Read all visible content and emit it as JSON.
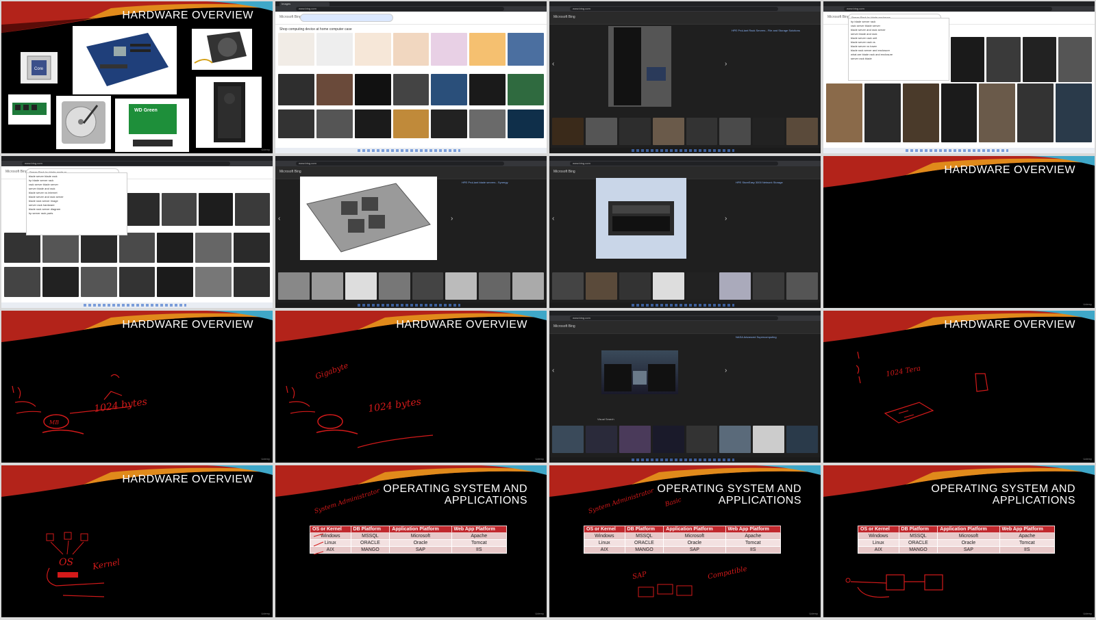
{
  "page": {
    "layout": "4x4 contact sheet of video frames",
    "watermark": "Udemy"
  },
  "slide_titles": {
    "hardware": "HARDWARE OVERVIEW",
    "os_apps": "OPERATING SYSTEM AND\nAPPLICATIONS"
  },
  "hardware_items": [
    "cpu-icon",
    "motherboard-icon",
    "power-supply-icon",
    "ram-stick-icon",
    "hard-drive-icon",
    "ssd-icon",
    "pc-case-icon"
  ],
  "ssd_label": "WD Green",
  "browser": {
    "brand": "Microsoft Bing",
    "url": "www.bing.com",
    "tab_label": "Images",
    "search_results_heading": "Shop computing device at home computer case",
    "queries": {
      "rack": "Server Rack by blade enclosure",
      "blade": "Server Rack hp blade mode ro"
    },
    "autocomplete_rack": [
      "hp blade server rack",
      "rack server blade server",
      "blade server and rack server",
      "server blade and rack",
      "blade server rack unit",
      "blade server rack vs",
      "blade server vs tower",
      "blade rack server and enclosure",
      "what are blade rack and enclosure",
      "server rack blade"
    ],
    "autocomplete_blade": [
      "blade server blade rack",
      "hp blade server rack",
      "rack server blade server",
      "server blade and rack",
      "blade server vs internet",
      "blade server and rack server",
      "blade rack server image",
      "server rack hardware",
      "blade rack server diagram",
      "hp server rack parts"
    ],
    "viewer_caption_1": "HPE ProLiant Rack Servers - File and Storage Solutions",
    "viewer_caption_2": "HPE ProLiant blade servers - Synergy",
    "viewer_caption_3": "HPE StoreEasy 3000 Network Storage",
    "viewer_caption_4": "NASA Advanced Supercomputing",
    "visual_search": "Visual Search"
  },
  "table": {
    "headers": [
      "OS or Kernel",
      "DB Platform",
      "Application Platform",
      "Web App Platform"
    ],
    "rows": [
      [
        "Windows",
        "MSSQL",
        "Microsoft",
        "Apache"
      ],
      [
        "Linux",
        "ORACLE",
        "Oracle",
        "Tomcat"
      ],
      [
        "AIX",
        "MANGO",
        "SAP",
        "IIS"
      ]
    ]
  },
  "handwriting": {
    "kb_note": "1024 bytes",
    "mb_note": "MB",
    "gb_note": "Gigabyte",
    "tera_note": "1024 Tera",
    "os_note": "OS",
    "kernel_note": "Kernel",
    "sysadmin_note": "System Administrator",
    "basic_note": "Basic",
    "compat_note": "Compatible",
    "sap_note": "SAP"
  },
  "colors": {
    "slide_bg": "#000000",
    "title": "#ffffff",
    "ink": "#d41a1a",
    "table_header": "#c0282d",
    "table_row_a": "#e7c8c8",
    "table_row_b": "#f3e1e1",
    "viewer_bg": "#1f1f1f"
  }
}
